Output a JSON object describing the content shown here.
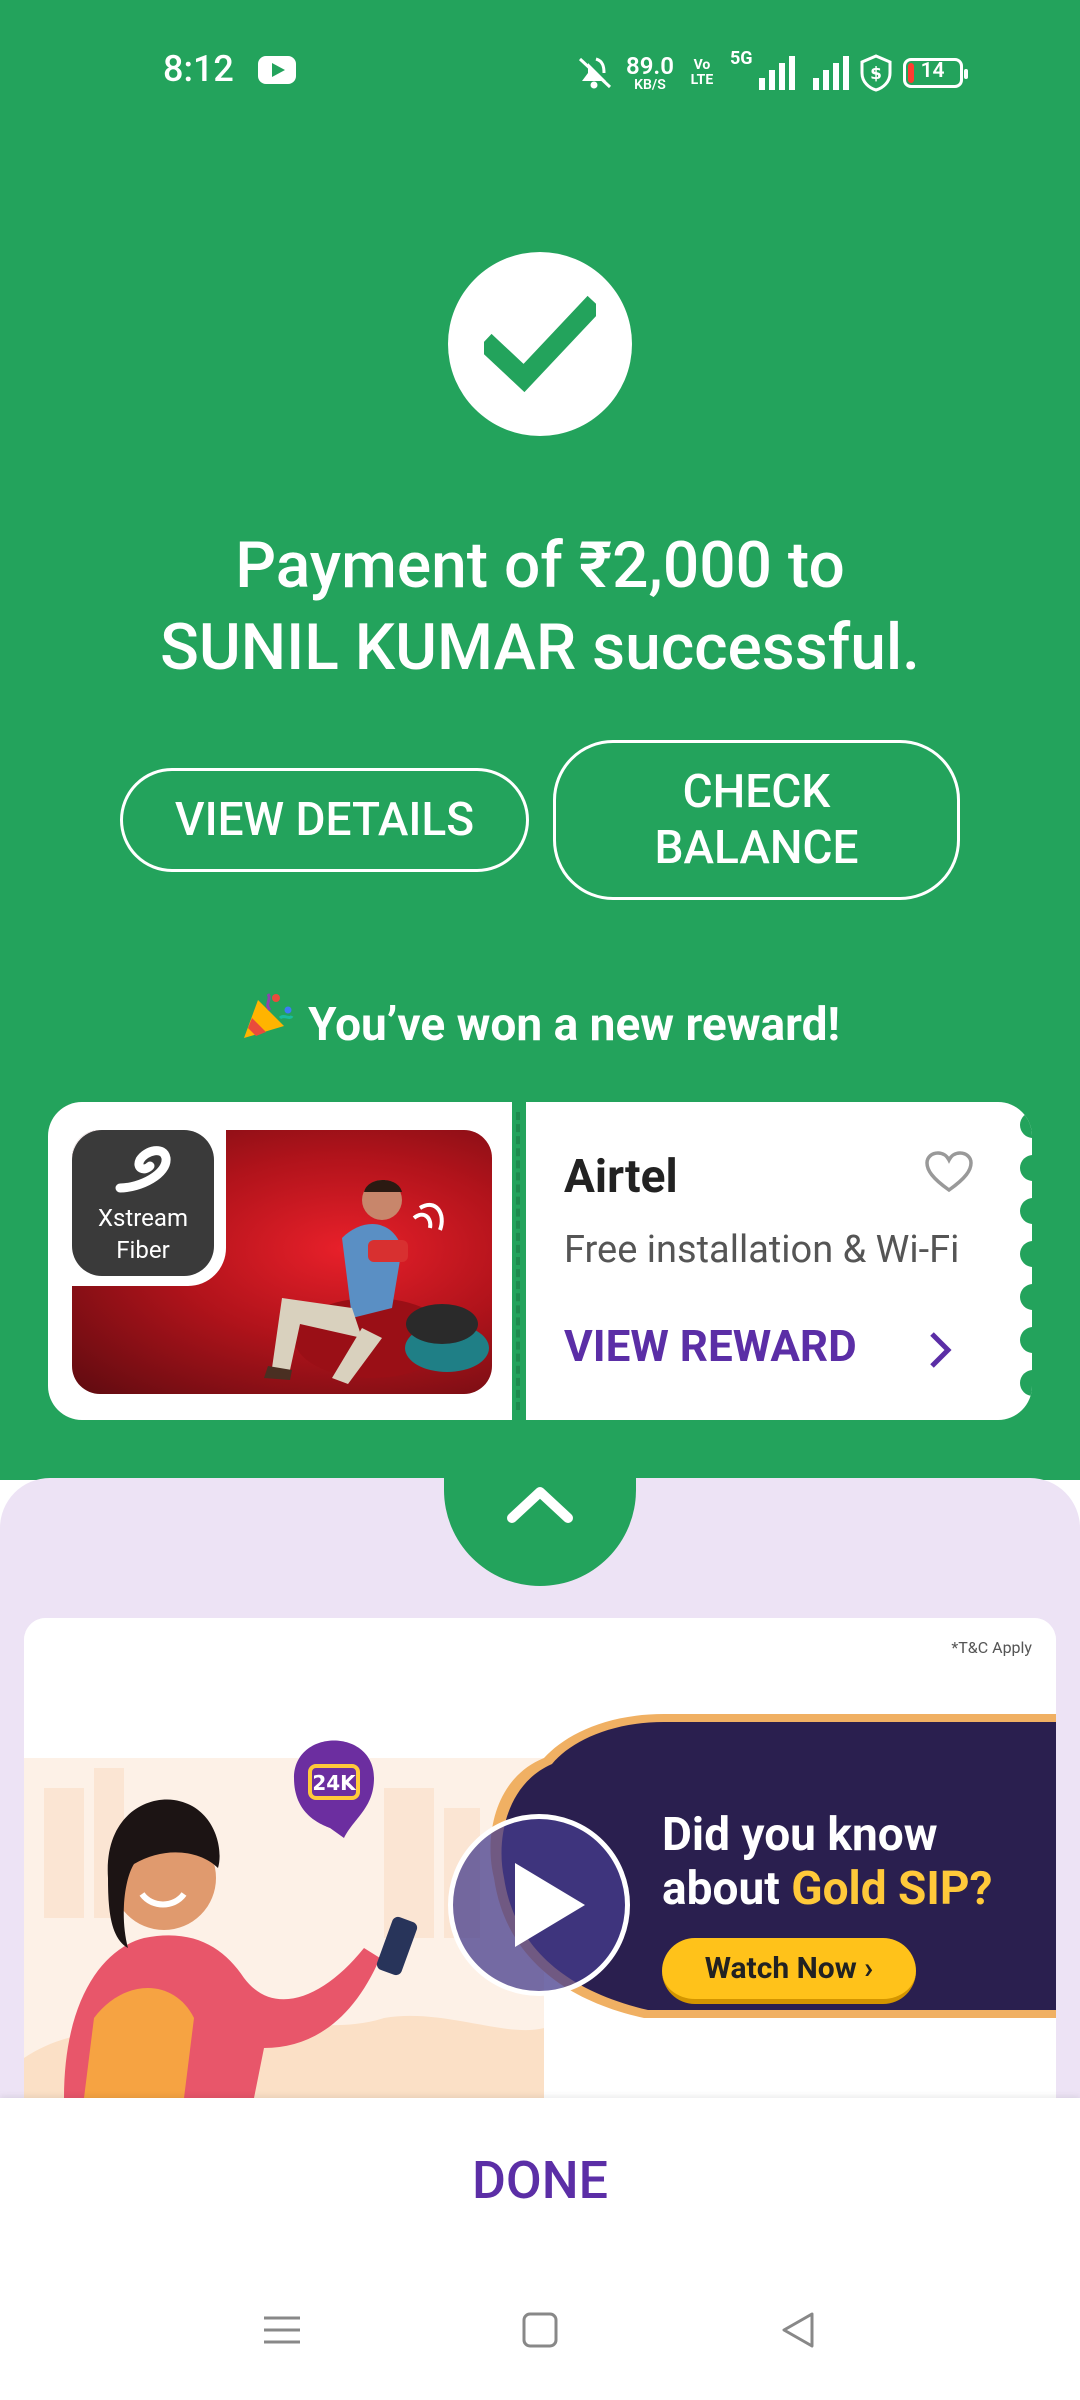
{
  "status_bar": {
    "time": "8:12",
    "speed_value": "89.0",
    "speed_unit": "KB/S",
    "volte": "Vo LTE",
    "network": "5G",
    "battery": "14"
  },
  "payment": {
    "headline": "Payment of ₹2,000 to\nSUNIL  KUMAR successful.",
    "view_details_label": "VIEW DETAILS",
    "check_balance_label": "CHECK\nBALANCE"
  },
  "reward": {
    "title": "You’ve won a new reward!",
    "image_logo_text": "Xstream\nFiber",
    "brand": "Airtel",
    "offer": "Free installation & Wi-Fi",
    "cta": "VIEW REWARD"
  },
  "banner": {
    "tnc": "*T&C Apply",
    "badge": "24K",
    "line1": "Did you know",
    "line2_prefix": "about ",
    "line2_highlight": "Gold SIP?",
    "cta": "Watch Now ›"
  },
  "footer": {
    "done_label": "DONE"
  },
  "colors": {
    "green": "#23a35c",
    "purple": "#5b2ea6",
    "lavender": "#ede3f5",
    "gold": "#ffc21a"
  }
}
